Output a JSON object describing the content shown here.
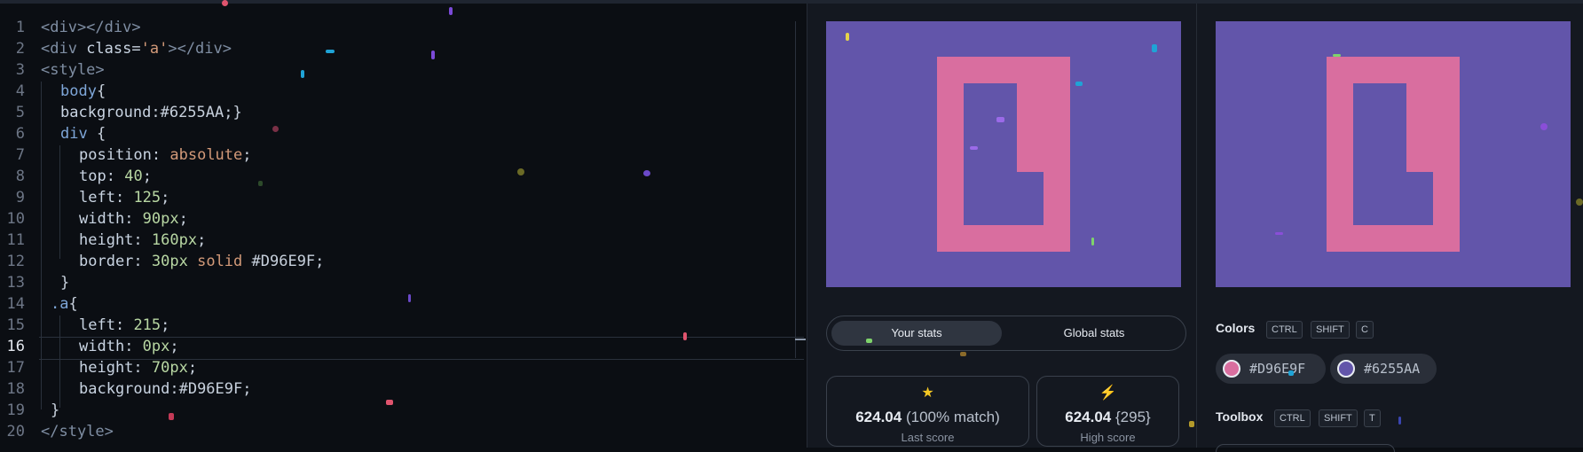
{
  "editor": {
    "current_line": 16,
    "lines": [
      {
        "n": "1"
      },
      {
        "n": "2"
      },
      {
        "n": "3"
      },
      {
        "n": "4"
      },
      {
        "n": "5"
      },
      {
        "n": "6"
      },
      {
        "n": "7"
      },
      {
        "n": "8"
      },
      {
        "n": "9"
      },
      {
        "n": "10"
      },
      {
        "n": "11"
      },
      {
        "n": "12"
      },
      {
        "n": "13"
      },
      {
        "n": "14"
      },
      {
        "n": "15"
      },
      {
        "n": "16"
      },
      {
        "n": "17"
      },
      {
        "n": "18"
      },
      {
        "n": "19"
      },
      {
        "n": "20"
      }
    ],
    "code": {
      "l1": "<div></div>",
      "l2_open": "<div ",
      "l2_attr": "class",
      "l2_eq": "=",
      "l2_val": "'a'",
      "l2_close": "></div>",
      "l3": "<style>",
      "l4_sel": "body",
      "l4_brace": "{",
      "l5_prop": "background",
      "l5_rest": ":#6255AA;}",
      "l6_sel": "div",
      "l6_brace": " {",
      "l7_prop": "position",
      "l7_colon": ": ",
      "l7_val": "absolute",
      "l7_semi": ";",
      "l8_prop": "top",
      "l8_colon": ": ",
      "l8_val": "40",
      "l8_semi": ";",
      "l9_prop": "left",
      "l9_colon": ": ",
      "l9_val": "125",
      "l9_semi": ";",
      "l10_prop": "width",
      "l10_colon": ": ",
      "l10_val": "90px",
      "l10_semi": ";",
      "l11_prop": "height",
      "l11_colon": ": ",
      "l11_val": "160px",
      "l11_semi": ";",
      "l12_prop": "border",
      "l12_colon": ": ",
      "l12_v1": "30px",
      "l12_v2": " solid",
      "l12_v3": " #D96E9F;",
      "l13": "}",
      "l14_sel": ".a",
      "l14_brace": "{",
      "l15_prop": "left",
      "l15_colon": ": ",
      "l15_val": "215",
      "l15_semi": ";",
      "l16_prop": "width",
      "l16_colon": ": ",
      "l16_val": "0px",
      "l16_semi": ";",
      "l17_prop": "height",
      "l17_colon": ": ",
      "l17_val": "70px",
      "l17_semi": ";",
      "l18_prop": "background",
      "l18_rest": ":#D96E9F;",
      "l19": "}",
      "l20": "</style>"
    }
  },
  "stats": {
    "your_stats_label": "Your stats",
    "global_stats_label": "Global stats",
    "last_score_value": "624.04",
    "last_score_match": "(100% match)",
    "last_score_label": "Last score",
    "high_score_value": "624.04",
    "high_score_count": "{295}",
    "high_score_label": "High score",
    "star_icon": "★",
    "bolt_icon": "⚡"
  },
  "colors": {
    "title": "Colors",
    "shortcut": [
      "CTRL",
      "SHIFT",
      "C"
    ],
    "swatches": [
      {
        "hex": "#D96E9F",
        "label": "#D96E9F"
      },
      {
        "hex": "#6255AA",
        "label": "#6255AA"
      }
    ]
  },
  "toolbox": {
    "title": "Toolbox",
    "shortcut": [
      "CTRL",
      "SHIFT",
      "T"
    ]
  },
  "palette": {
    "background": "#6255AA",
    "accent": "#D96E9F"
  }
}
